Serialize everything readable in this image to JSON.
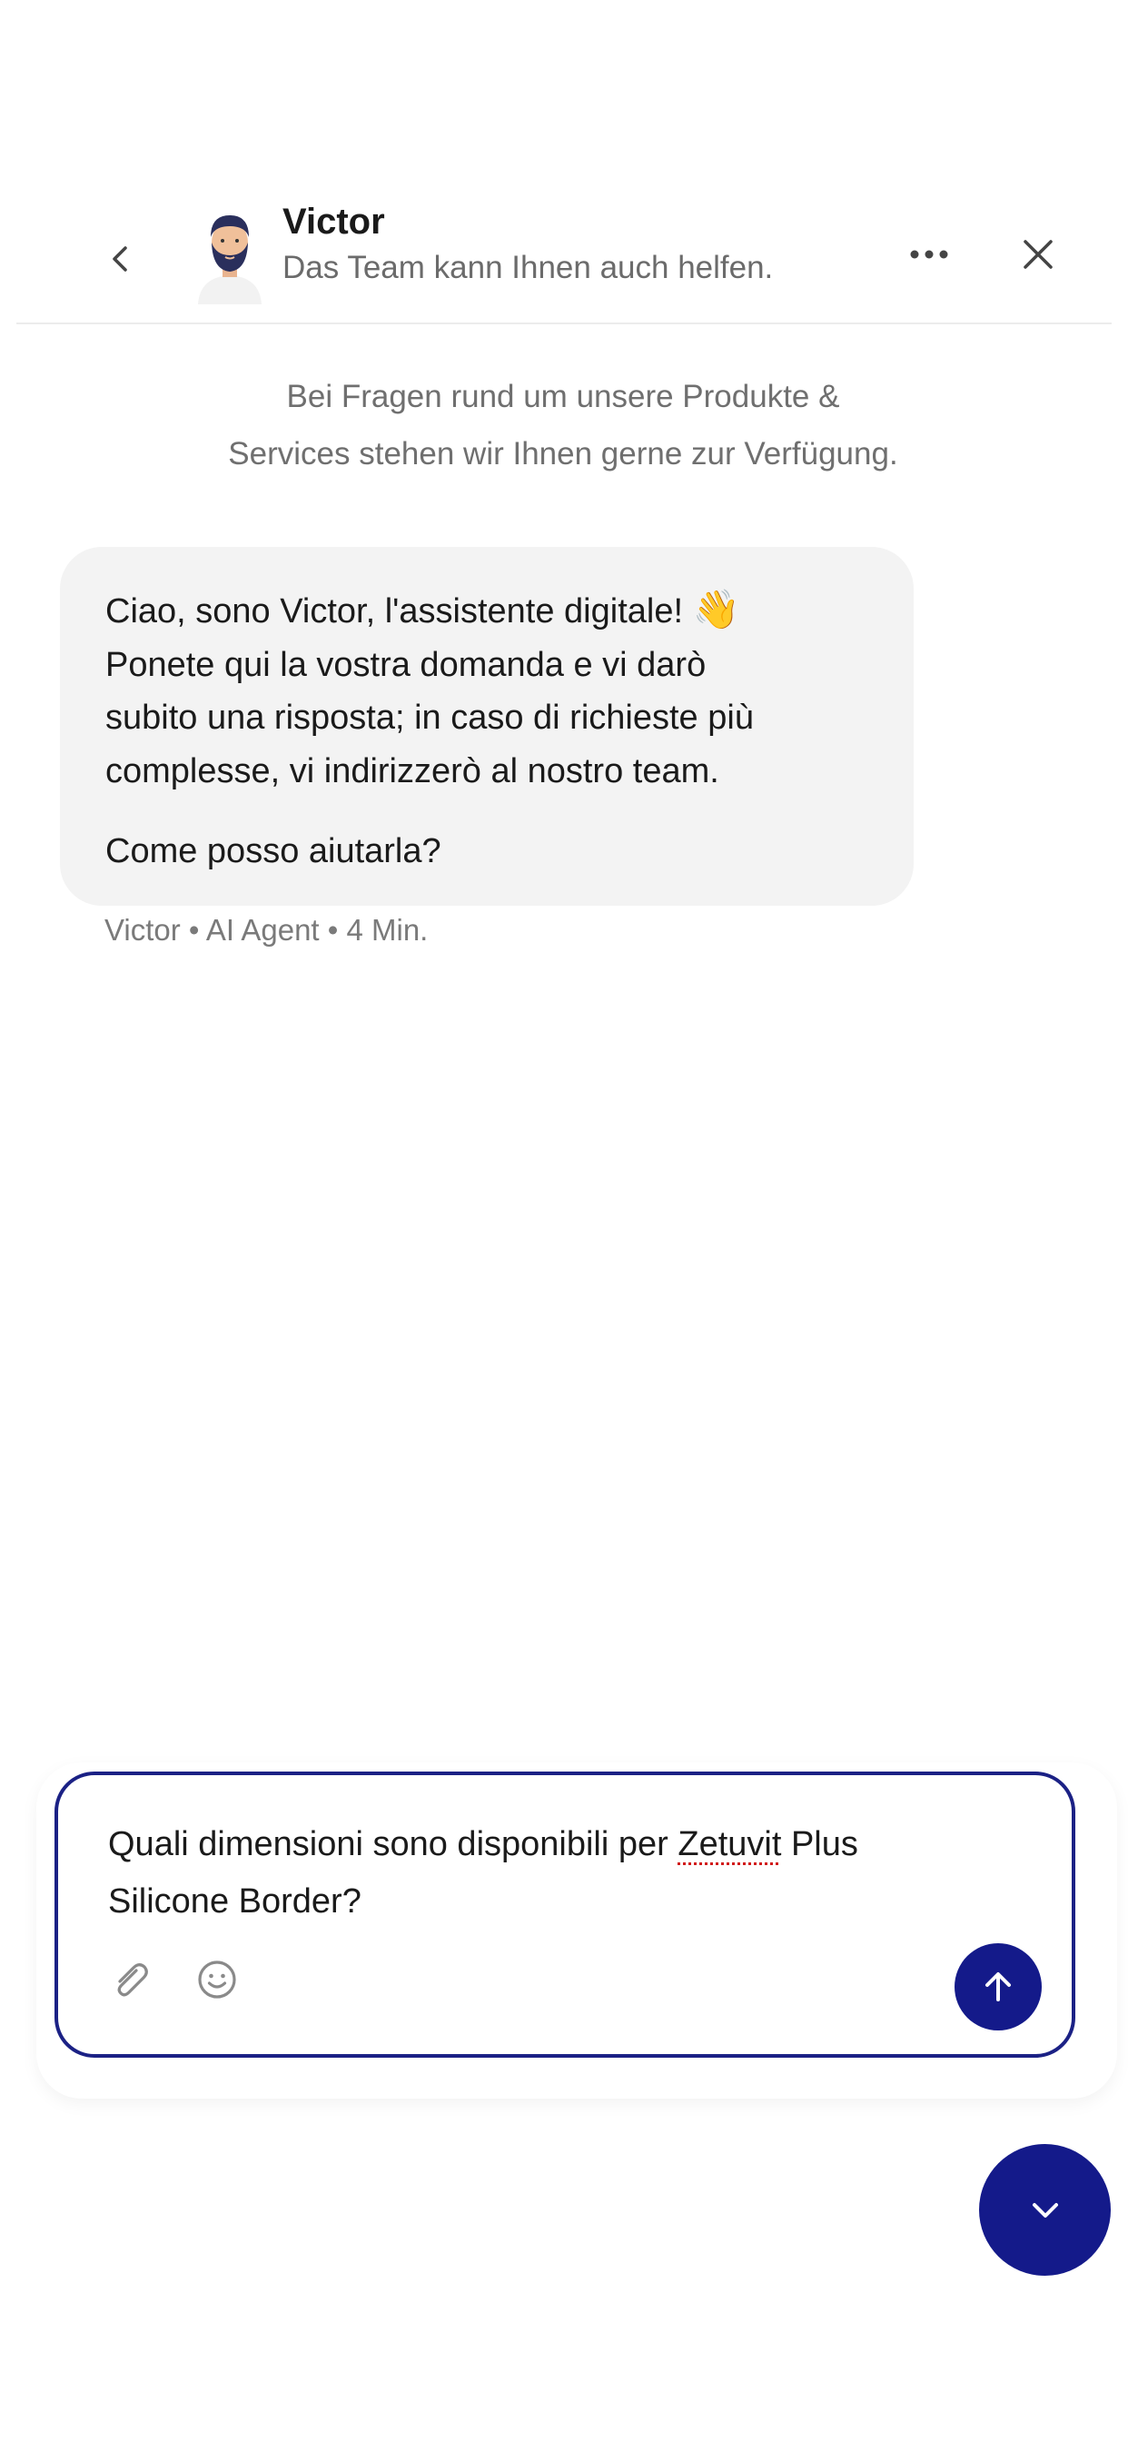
{
  "header": {
    "title": "Victor",
    "subtitle": "Das Team kann Ihnen auch helfen.",
    "back_icon": "chevron-left-icon",
    "more_icon": "more-horizontal-icon",
    "close_icon": "close-icon"
  },
  "intro": {
    "line1": "Bei Fragen rund um unsere Produkte &",
    "line2": "Services stehen wir Ihnen gerne zur Verfügung."
  },
  "message": {
    "paragraph1_lines": [
      "Ciao, sono Victor, l'assistente digitale!",
      "Ponete qui la vostra domanda e vi darò",
      "subito una risposta; in caso di richieste più",
      "complesse, vi indirizzerò al nostro team."
    ],
    "wave_emoji": "👋",
    "paragraph2": "Come posso aiutarla?",
    "meta": "Victor • AI Agent • 4 Min."
  },
  "composer": {
    "text_part1": "Quali dimensioni sono disponibili per ",
    "text_misspelled": "Zetuvit",
    "text_part2": " Plus",
    "text_line2": "Silicone Border?",
    "attach_icon": "paperclip-icon",
    "emoji_icon": "smiley-icon",
    "send_icon": "arrow-up-icon"
  },
  "scroll_down_icon": "chevron-down-icon",
  "colors": {
    "accent": "#141a8a",
    "bubble_bg": "#f3f3f3",
    "muted_text": "#6f6f6f"
  }
}
